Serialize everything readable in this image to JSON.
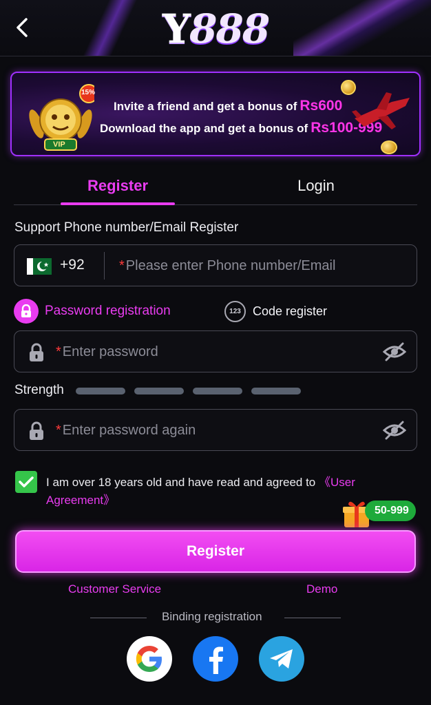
{
  "header": {
    "logo_y": "Y",
    "logo_num": "888"
  },
  "banner": {
    "line1_text": "Invite a friend and get a bonus of",
    "line1_amount": "Rs600",
    "line2_text": "Download the app and get a bonus of",
    "line2_amount": "Rs100-999",
    "badge_percent": "15%",
    "badge_vip": "VIP"
  },
  "tabs": {
    "register": "Register",
    "login": "Login"
  },
  "form": {
    "section_title": "Support Phone number/Email Register",
    "country_code": "+92",
    "phone_placeholder": "Please enter Phone number/Email",
    "password_registration": "Password registration",
    "code_register": "Code register",
    "code_icon_text": "123",
    "password_placeholder": "Enter password",
    "strength_label": "Strength",
    "password_again_placeholder": "Enter password again",
    "required_mark": "*"
  },
  "agreement": {
    "text": "I am over 18 years old and have read and agreed to",
    "link": "《User Agreement》",
    "checked": true
  },
  "bonus": {
    "pill": "50-999"
  },
  "actions": {
    "register_button": "Register",
    "customer_service": "Customer Service",
    "demo": "Demo"
  },
  "binding": {
    "label": "Binding registration",
    "providers": [
      "google-icon",
      "facebook-icon",
      "telegram-icon"
    ]
  },
  "colors": {
    "accent": "#e93cf0",
    "background": "#0b0b0f",
    "check_green": "#35c54a"
  }
}
